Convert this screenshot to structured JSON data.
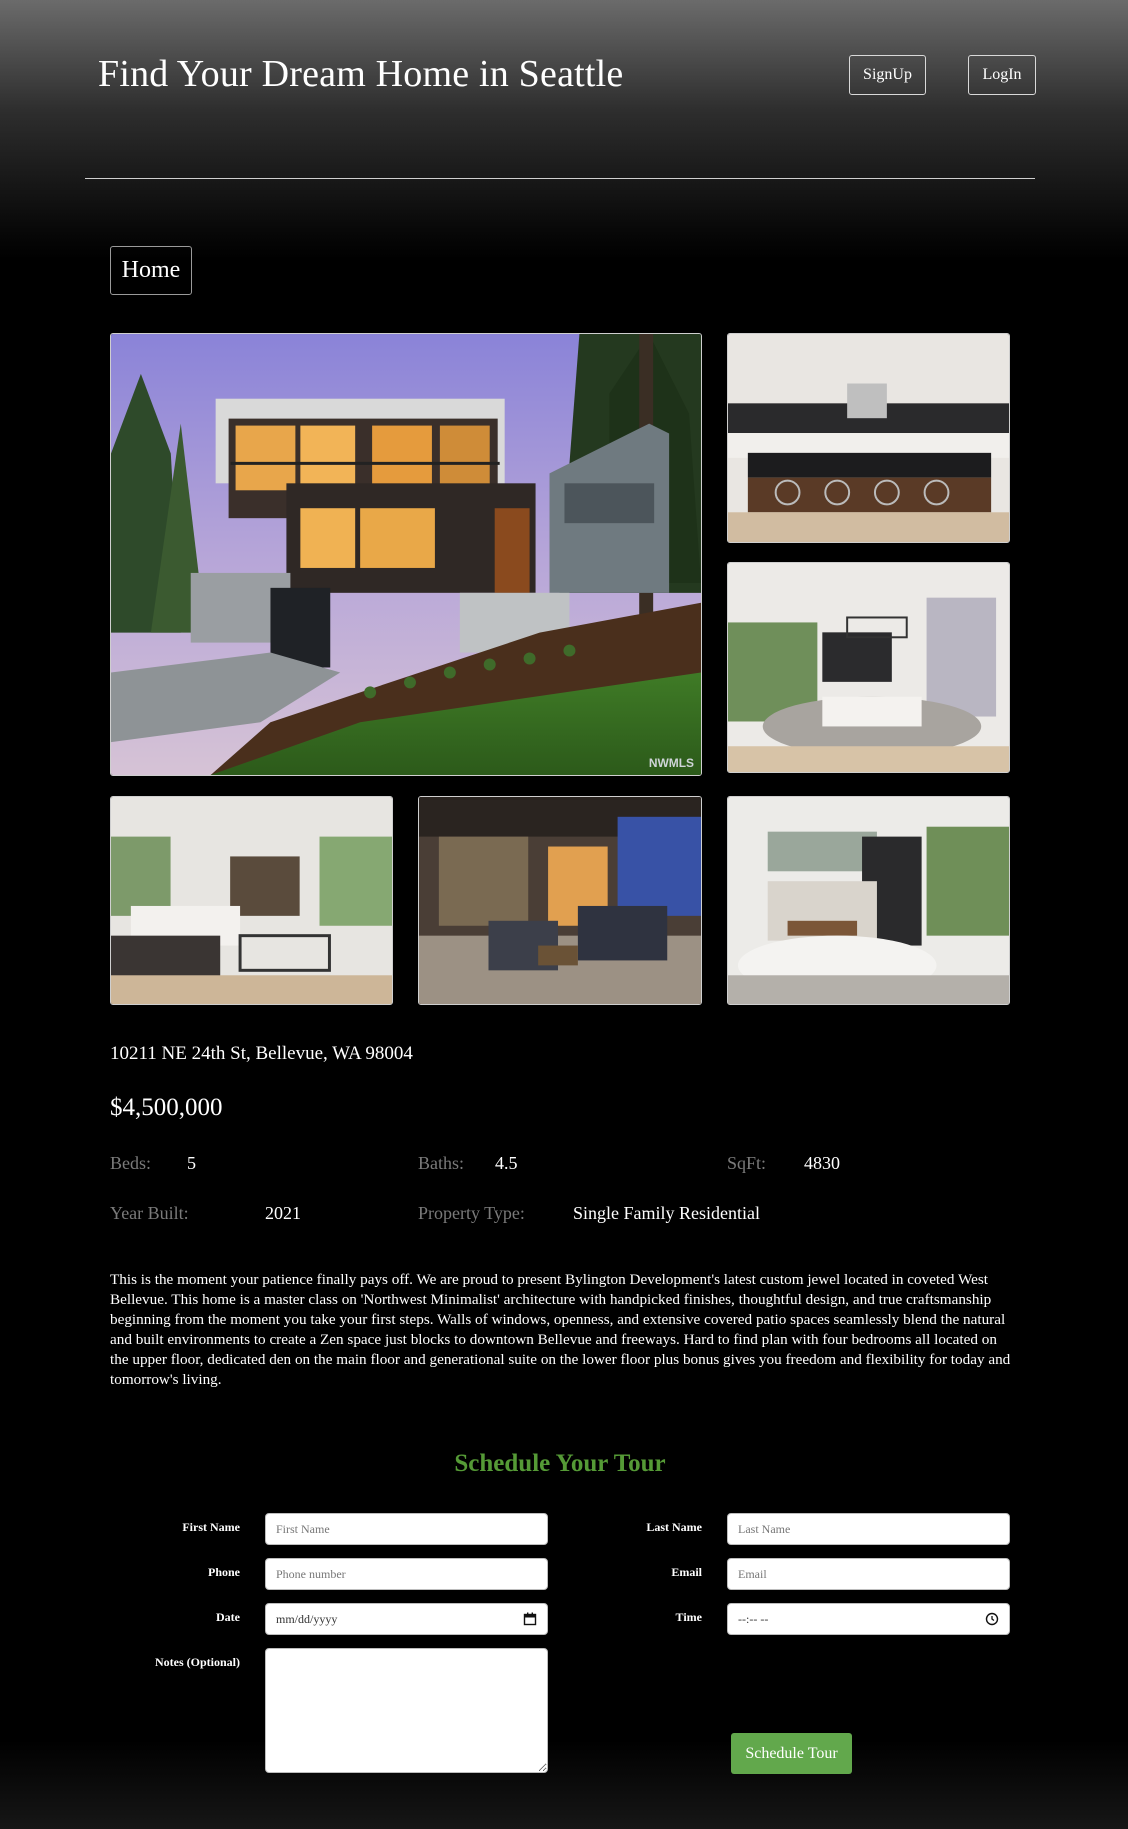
{
  "header": {
    "title": "Find Your Dream Home in Seattle",
    "signup_label": "SignUp",
    "login_label": "LogIn"
  },
  "nav": {
    "home_label": "Home"
  },
  "gallery": {
    "watermark": "NWMLS",
    "photos": [
      "exterior",
      "kitchen",
      "dining-room",
      "living-room",
      "patio",
      "bedroom"
    ]
  },
  "listing": {
    "address": "10211 NE 24th St, Bellevue, WA 98004",
    "price": "$4,500,000",
    "beds_label": "Beds:",
    "beds": "5",
    "baths_label": "Baths:",
    "baths": "4.5",
    "sqft_label": "SqFt:",
    "sqft": "4830",
    "year_label": "Year Built:",
    "year": "2021",
    "type_label": "Property Type:",
    "type": "Single Family Residential",
    "description": "This is the moment your patience finally pays off. We are proud to present Bylington Development's latest custom jewel located in coveted West Bellevue. This home is a master class on 'Northwest Minimalist' architecture with handpicked finishes, thoughtful design, and true craftsmanship beginning from the moment you take your first steps. Walls of windows, openness, and extensive covered patio spaces seamlessly blend the natural and built environments to create a Zen space just blocks to downtown Bellevue and freeways. Hard to find plan with four bedrooms all located on the upper floor, dedicated den on the main floor and generational suite on the lower floor plus bonus gives you freedom and flexibility for today and tomorrow's living."
  },
  "tour_form": {
    "title": "Schedule Your Tour",
    "first_name_label": "First Name",
    "first_name_placeholder": "First Name",
    "first_name_value": "",
    "last_name_label": "Last Name",
    "last_name_placeholder": "Last Name",
    "last_name_value": "",
    "phone_label": "Phone",
    "phone_placeholder": "Phone number",
    "phone_value": "",
    "email_label": "Email",
    "email_placeholder": "Email",
    "email_value": "",
    "date_label": "Date",
    "date_placeholder": "mm/dd/yyyy",
    "time_label": "Time",
    "time_placeholder": "--:-- --",
    "notes_label": "Notes (Optional)",
    "notes_value": "",
    "submit_label": "Schedule Tour"
  },
  "colors": {
    "accent_green": "#62a84c",
    "title_green": "#559a36",
    "muted_label": "#7a7a7a",
    "background": "#000000"
  }
}
